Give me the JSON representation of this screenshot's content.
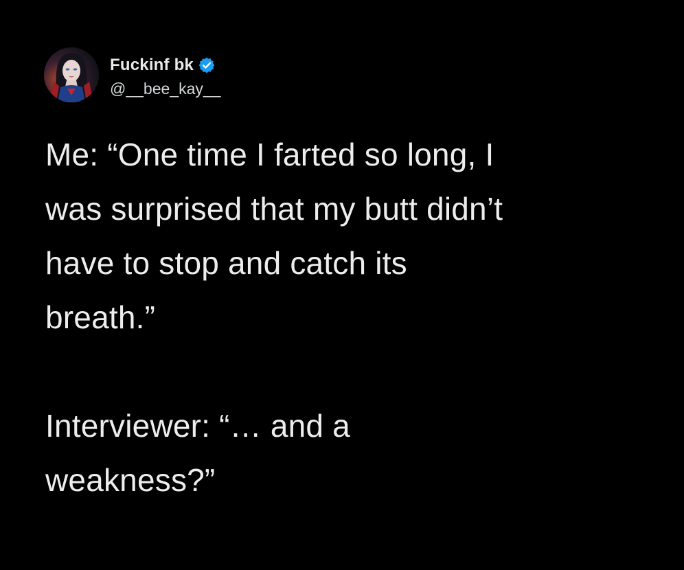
{
  "author": {
    "display_name": "Fuckinf bk",
    "handle": "@__bee_kay__",
    "verified": true,
    "verified_color": "#1d9bf0"
  },
  "tweet": {
    "text": "Me: “One time I farted so long, I\nwas surprised that my butt didn’t\nhave to stop and catch its\nbreath.”\n\nInterviewer: “… and a\nweakness?”"
  },
  "icons": {
    "avatar": "avatar-image",
    "badge": "verified-badge-icon"
  }
}
